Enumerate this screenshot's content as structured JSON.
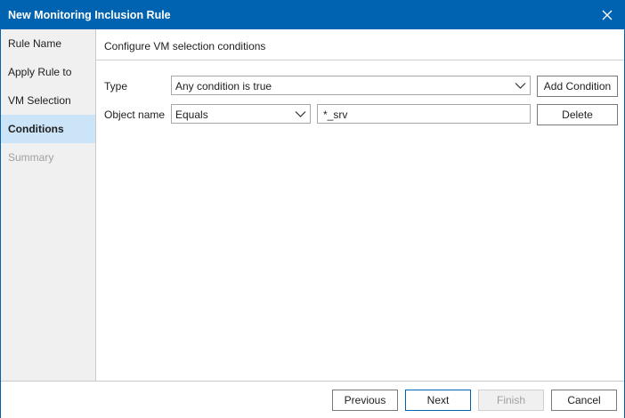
{
  "window": {
    "title": "New Monitoring Inclusion Rule"
  },
  "sidebar": {
    "steps": [
      {
        "label": "Rule Name",
        "state": "normal"
      },
      {
        "label": "Apply Rule to",
        "state": "normal"
      },
      {
        "label": "VM Selection",
        "state": "normal"
      },
      {
        "label": "Conditions",
        "state": "active"
      },
      {
        "label": "Summary",
        "state": "disabled"
      }
    ]
  },
  "main": {
    "header": "Configure VM selection conditions",
    "type_row": {
      "label": "Type",
      "selected": "Any condition is true",
      "button_label": "Add Condition"
    },
    "condition_row": {
      "label": "Object name",
      "operator": "Equals",
      "value": "*_srv",
      "button_label": "Delete"
    }
  },
  "footer": {
    "previous_label": "Previous",
    "next_label": "Next",
    "finish_label": "Finish",
    "cancel_label": "Cancel"
  },
  "colors": {
    "titlebar": "#0063b1",
    "active_step": "#cce4f7",
    "sidebar_bg": "#f0f0f0"
  },
  "icons": {
    "close": "close-icon",
    "dropdown": "chevron-down-icon"
  }
}
